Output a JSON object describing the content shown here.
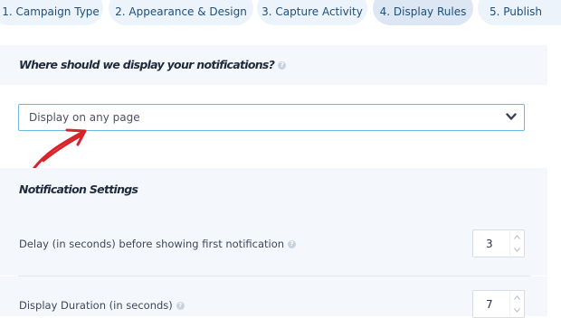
{
  "tabs": [
    {
      "label": "1. Campaign Type",
      "active": false
    },
    {
      "label": "2. Appearance & Design",
      "active": false
    },
    {
      "label": "3. Capture Activity",
      "active": false
    },
    {
      "label": "4. Display Rules",
      "active": true
    },
    {
      "label": "5. Publish",
      "active": false
    }
  ],
  "display_section": {
    "title": "Where should we display your notifications?",
    "select_value": "Display on any page"
  },
  "notification_settings": {
    "title": "Notification Settings",
    "delay_label": "Delay (in seconds) before showing first notification",
    "delay_value": "3",
    "duration_label": "Display Duration (in seconds)",
    "duration_value": "7"
  },
  "colors": {
    "tab_bg": "#edf3fb",
    "tab_text": "#1d4f7a",
    "panel_bg": "#f4f8fc",
    "select_border": "#6fb6e0",
    "annotation_arrow": "#d8232a"
  },
  "icons": [
    "help-icon",
    "chevron-down-icon",
    "spinner-up-icon",
    "spinner-down-icon",
    "annotation-arrow"
  ]
}
